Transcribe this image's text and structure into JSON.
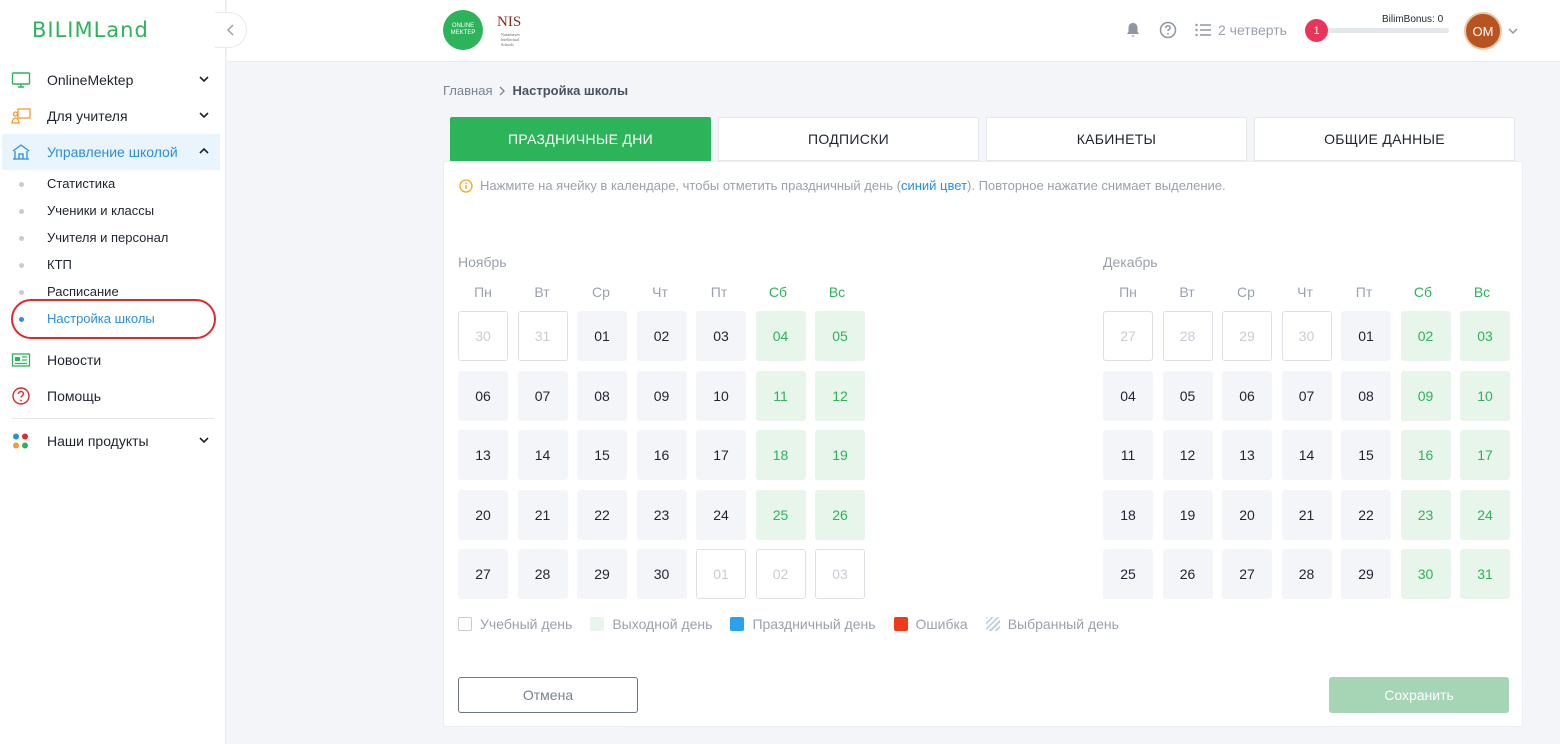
{
  "brand": {
    "logo_text": "BILIMLand",
    "accent": "#2db35a",
    "link_blue": "#2a8fdc"
  },
  "sidebar": {
    "items": [
      {
        "label": "OnlineMektep",
        "icon": "monitor-icon"
      },
      {
        "label": "Для учителя",
        "icon": "teacher-icon"
      },
      {
        "label": "Управление школой",
        "icon": "school-icon",
        "active": true,
        "children": [
          {
            "label": "Статистика"
          },
          {
            "label": "Ученики и классы"
          },
          {
            "label": "Учителя и персонал"
          },
          {
            "label": "КТП"
          },
          {
            "label": "Расписание"
          },
          {
            "label": "Настройка школы",
            "current": true
          }
        ]
      },
      {
        "label": "Новости",
        "icon": "news-icon"
      },
      {
        "label": "Помощь",
        "icon": "help-icon"
      },
      {
        "label": "Наши продукты",
        "icon": "products-icon"
      }
    ]
  },
  "topbar": {
    "online_mektep_logo": "ONLINE MEKTEP",
    "nis_logo": {
      "title": "NIS",
      "subtitle": "Nazarbayev Intellectual Schools"
    },
    "quarter": "2 четверть",
    "notifications_count": "1",
    "bilimbonus_label": "BilimBonus: 0",
    "bilimbonus_progress": 0,
    "avatar_initials": "OM"
  },
  "breadcrumb": {
    "home": "Главная",
    "current": "Настройка школы"
  },
  "tabs": [
    "ПРАЗДНИЧНЫЕ ДНИ",
    "ПОДПИСКИ",
    "КАБИНЕТЫ",
    "ОБЩИЕ ДАННЫЕ"
  ],
  "hint": {
    "before": "Нажмите на ячейку в календаре, чтобы отметить праздничный день (",
    "blue": "синий цвет",
    "after": "). Повторное нажатие снимает выделение."
  },
  "weekdays": [
    "Пн",
    "Вт",
    "Ср",
    "Чт",
    "Пт",
    "Сб",
    "Вс"
  ],
  "months": [
    {
      "name": "Ноябрь",
      "days": [
        {
          "d": "30",
          "t": "other"
        },
        {
          "d": "31",
          "t": "other"
        },
        {
          "d": "01",
          "t": "study"
        },
        {
          "d": "02",
          "t": "study"
        },
        {
          "d": "03",
          "t": "study"
        },
        {
          "d": "04",
          "t": "off"
        },
        {
          "d": "05",
          "t": "off"
        },
        {
          "d": "06",
          "t": "study"
        },
        {
          "d": "07",
          "t": "study"
        },
        {
          "d": "08",
          "t": "study"
        },
        {
          "d": "09",
          "t": "study"
        },
        {
          "d": "10",
          "t": "study"
        },
        {
          "d": "11",
          "t": "off"
        },
        {
          "d": "12",
          "t": "off"
        },
        {
          "d": "13",
          "t": "study"
        },
        {
          "d": "14",
          "t": "study"
        },
        {
          "d": "15",
          "t": "study"
        },
        {
          "d": "16",
          "t": "study"
        },
        {
          "d": "17",
          "t": "study"
        },
        {
          "d": "18",
          "t": "off"
        },
        {
          "d": "19",
          "t": "off"
        },
        {
          "d": "20",
          "t": "study"
        },
        {
          "d": "21",
          "t": "study"
        },
        {
          "d": "22",
          "t": "study"
        },
        {
          "d": "23",
          "t": "study"
        },
        {
          "d": "24",
          "t": "study"
        },
        {
          "d": "25",
          "t": "off"
        },
        {
          "d": "26",
          "t": "off"
        },
        {
          "d": "27",
          "t": "study"
        },
        {
          "d": "28",
          "t": "study"
        },
        {
          "d": "29",
          "t": "study"
        },
        {
          "d": "30",
          "t": "study"
        },
        {
          "d": "01",
          "t": "other"
        },
        {
          "d": "02",
          "t": "other"
        },
        {
          "d": "03",
          "t": "other"
        }
      ]
    },
    {
      "name": "Декабрь",
      "days": [
        {
          "d": "27",
          "t": "other"
        },
        {
          "d": "28",
          "t": "other"
        },
        {
          "d": "29",
          "t": "other"
        },
        {
          "d": "30",
          "t": "other"
        },
        {
          "d": "01",
          "t": "study"
        },
        {
          "d": "02",
          "t": "off"
        },
        {
          "d": "03",
          "t": "off"
        },
        {
          "d": "04",
          "t": "study"
        },
        {
          "d": "05",
          "t": "study"
        },
        {
          "d": "06",
          "t": "study"
        },
        {
          "d": "07",
          "t": "study"
        },
        {
          "d": "08",
          "t": "study"
        },
        {
          "d": "09",
          "t": "off"
        },
        {
          "d": "10",
          "t": "off"
        },
        {
          "d": "11",
          "t": "study"
        },
        {
          "d": "12",
          "t": "study"
        },
        {
          "d": "13",
          "t": "study"
        },
        {
          "d": "14",
          "t": "study"
        },
        {
          "d": "15",
          "t": "study"
        },
        {
          "d": "16",
          "t": "off"
        },
        {
          "d": "17",
          "t": "off"
        },
        {
          "d": "18",
          "t": "study"
        },
        {
          "d": "19",
          "t": "study"
        },
        {
          "d": "20",
          "t": "study"
        },
        {
          "d": "21",
          "t": "study"
        },
        {
          "d": "22",
          "t": "study"
        },
        {
          "d": "23",
          "t": "off"
        },
        {
          "d": "24",
          "t": "off"
        },
        {
          "d": "25",
          "t": "study"
        },
        {
          "d": "26",
          "t": "study"
        },
        {
          "d": "27",
          "t": "study"
        },
        {
          "d": "28",
          "t": "study"
        },
        {
          "d": "29",
          "t": "study"
        },
        {
          "d": "30",
          "t": "off"
        },
        {
          "d": "31",
          "t": "off"
        }
      ]
    }
  ],
  "legend": {
    "study": "Учебный день",
    "off": "Выходной день",
    "holiday": "Праздничный день",
    "error": "Ошибка",
    "selected": "Выбранный день"
  },
  "buttons": {
    "cancel": "Отмена",
    "save": "Сохранить"
  }
}
